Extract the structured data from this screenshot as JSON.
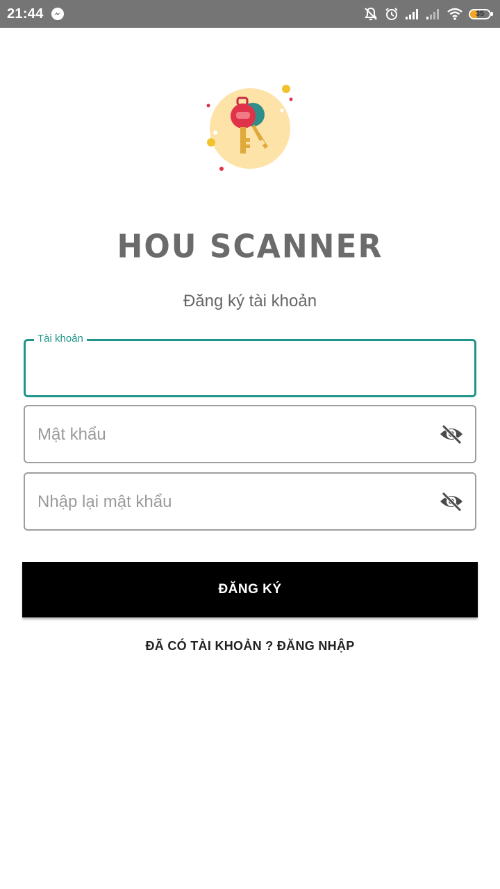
{
  "status_bar": {
    "time": "21:44",
    "notification_icon": "messenger-icon",
    "icons": [
      "muted-bell-icon",
      "alarm-icon",
      "signal-icon",
      "signal-weak-icon",
      "wifi-icon"
    ],
    "battery_level": "35",
    "battery_color": "#f4a623"
  },
  "logo": {
    "icon": "keys-logo-icon",
    "circle_color": "#fde3a7",
    "accent_color": "#e0334a"
  },
  "header": {
    "app_title": "HOU SCANNER",
    "subtitle": "Đăng ký tài khoản"
  },
  "form": {
    "account": {
      "label": "Tài khoản",
      "value": "",
      "accent_color": "#1f958a"
    },
    "password": {
      "placeholder": "Mật khẩu",
      "toggle_icon": "eye-off-icon"
    },
    "confirm_password": {
      "placeholder": "Nhập lại mật khẩu",
      "toggle_icon": "eye-off-icon"
    }
  },
  "actions": {
    "register_label": "ĐĂNG KÝ",
    "login_link_label": "ĐÃ CÓ TÀI KHOẢN ? ĐĂNG NHẬP"
  }
}
